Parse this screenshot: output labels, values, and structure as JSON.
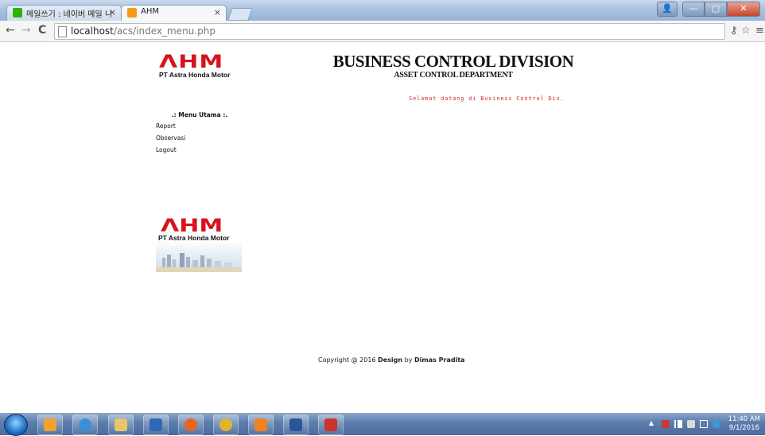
{
  "browser": {
    "tabs": [
      {
        "label": "메일쓰기 : 네이버 메일 니",
        "favicon_color": "#2db400"
      },
      {
        "label": "AHM",
        "favicon_color": "#f39a1a"
      }
    ],
    "tab_close_glyph": "×",
    "window_buttons": {
      "user": "👤",
      "minimize": "—",
      "maximize": "▢",
      "close": "✕"
    },
    "nav": {
      "back": "←",
      "forward": "→",
      "reload": "C"
    },
    "url_host": "localhost",
    "url_path": "/acs/index_menu.php",
    "toolbar_icons": {
      "key": "⚷",
      "star": "☆",
      "menu": "≡"
    }
  },
  "page": {
    "logo": {
      "mark": "ΛHM",
      "subtitle": "PT Astra Honda Motor"
    },
    "header": {
      "title": "BUSINESS CONTROL DIVISION",
      "subtitle": "ASSET CONTROL DEPARTMENT"
    },
    "welcome": "Selamat datang di Business Control Div.",
    "menu": {
      "title": ".: Menu Utama :.",
      "items": [
        "Report",
        "Observasi",
        "Logout"
      ]
    },
    "banner": {
      "mark": "ΛHM",
      "subtitle": "PT Astra Honda Motor"
    },
    "footer": {
      "prefix": "Copyright @ 2016 ",
      "design": "Design",
      "by": " by ",
      "author": "Dimas Pradita"
    }
  },
  "taskbar": {
    "pinned": [
      {
        "name": "outlook",
        "color": "#f1a22b"
      },
      {
        "name": "internet-explorer",
        "color": "#3b8fdc"
      },
      {
        "name": "file-explorer",
        "color": "#e8c56a"
      },
      {
        "name": "media-player",
        "color": "#2d67b6"
      },
      {
        "name": "firefox",
        "color": "#e8661a"
      },
      {
        "name": "chrome",
        "color": "#e0b52a"
      },
      {
        "name": "xampp",
        "color": "#f0821f"
      },
      {
        "name": "word",
        "color": "#2a5699"
      },
      {
        "name": "app",
        "color": "#c8352b"
      }
    ],
    "clock": {
      "time": "11:40 AM",
      "date": "9/1/2016"
    }
  }
}
